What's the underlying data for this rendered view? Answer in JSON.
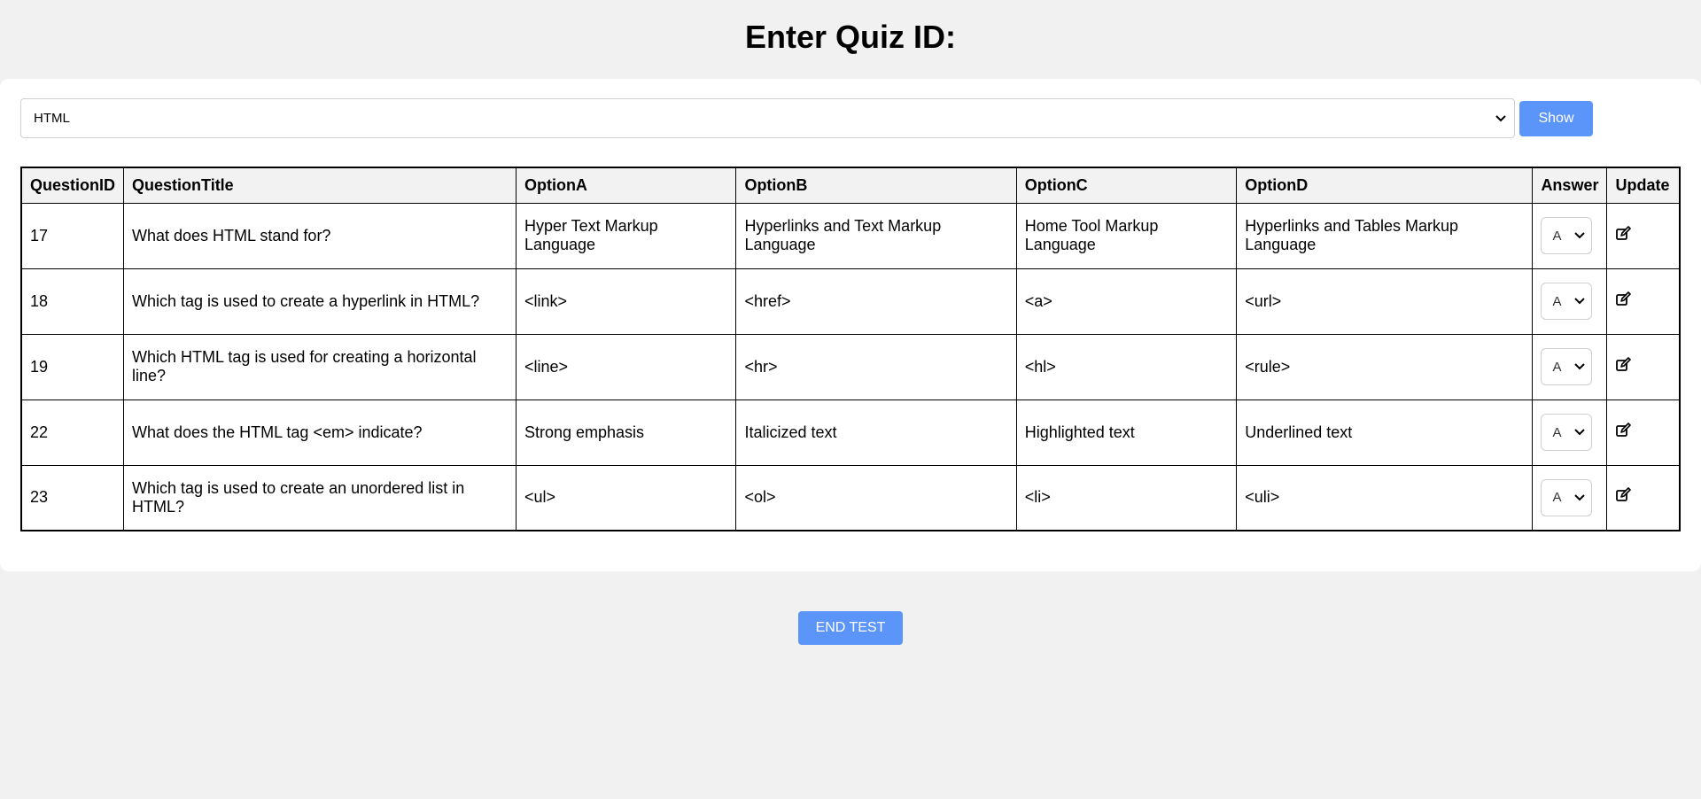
{
  "page": {
    "title": "Enter Quiz ID:"
  },
  "controls": {
    "quiz_select_value": "HTML",
    "show_label": "Show"
  },
  "table": {
    "headers": [
      "QuestionID",
      "QuestionTitle",
      "OptionA",
      "OptionB",
      "OptionC",
      "OptionD",
      "Answer",
      "Update"
    ],
    "rows": [
      {
        "id": "17",
        "title": "What does HTML stand for?",
        "option_a": "Hyper Text Markup Language",
        "option_b": "Hyperlinks and Text Markup Language",
        "option_c": "Home Tool Markup Language",
        "option_d": "Hyperlinks and Tables Markup Language",
        "answer": "A"
      },
      {
        "id": "18",
        "title": "Which tag is used to create a hyperlink in HTML?",
        "option_a": "<link>",
        "option_b": "<href>",
        "option_c": "<a>",
        "option_d": "<url>",
        "answer": "A"
      },
      {
        "id": "19",
        "title": "Which HTML tag is used for creating a horizontal line?",
        "option_a": "<line>",
        "option_b": "<hr>",
        "option_c": "<hl>",
        "option_d": "<rule>",
        "answer": "A"
      },
      {
        "id": "22",
        "title": "What does the HTML tag <em> indicate?",
        "option_a": "Strong emphasis",
        "option_b": "Italicized text",
        "option_c": "Highlighted text",
        "option_d": "Underlined text",
        "answer": "A"
      },
      {
        "id": "23",
        "title": "Which tag is used to create an unordered list in HTML?",
        "option_a": "<ul>",
        "option_b": "<ol>",
        "option_c": "<li>",
        "option_d": "<uli>",
        "answer": "A"
      }
    ]
  },
  "footer": {
    "end_test_label": "END TEST"
  },
  "icons": {
    "dropdown": "chevron-down-icon",
    "update": "edit-icon"
  },
  "colors": {
    "accent": "#5b95f9",
    "background": "#f1f1f1",
    "card": "#ffffff",
    "header_row": "#f2f2f2"
  }
}
